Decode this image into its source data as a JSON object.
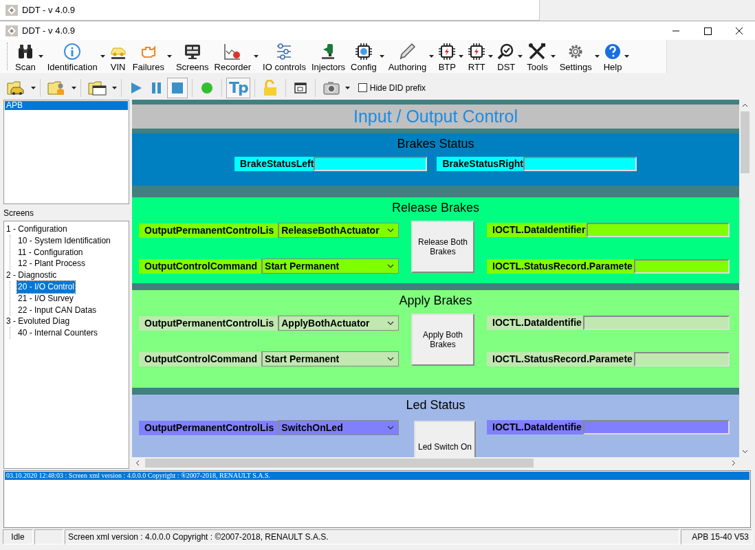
{
  "outer_window": {
    "title": "DDT - v 4.0.9"
  },
  "window": {
    "title": "DDT - v 4.0.9"
  },
  "toolbar": [
    {
      "label": "Scan",
      "dropdown": true
    },
    {
      "label": "Identification",
      "dropdown": true
    },
    {
      "label": "VIN",
      "dropdown": false
    },
    {
      "label": "Failures",
      "dropdown": true
    },
    {
      "label": "Screens",
      "dropdown": false
    },
    {
      "label": "Recorder",
      "dropdown": true
    },
    {
      "label": "IO controls",
      "dropdown": false
    },
    {
      "label": "Injectors",
      "dropdown": false
    },
    {
      "label": "Config",
      "dropdown": true
    },
    {
      "label": "Authoring",
      "dropdown": true
    },
    {
      "label": "BTP",
      "dropdown": true
    },
    {
      "label": "RTT",
      "dropdown": true
    },
    {
      "label": "DST",
      "dropdown": true
    },
    {
      "label": "Tools",
      "dropdown": true
    },
    {
      "label": "Settings",
      "dropdown": true
    },
    {
      "label": "Help",
      "dropdown": true
    }
  ],
  "tool_buttons": [
    {
      "pressed": false,
      "dropdown": true
    },
    {
      "pressed": false,
      "dropdown": true
    },
    {
      "pressed": false,
      "dropdown": true
    },
    {
      "pressed": false,
      "dropdown": false
    },
    {
      "pressed": false,
      "dropdown": false
    },
    {
      "pressed": true,
      "dropdown": false
    },
    {
      "pressed": false,
      "dropdown": false
    },
    {
      "pressed": true,
      "dropdown": false,
      "text": "Tp"
    },
    {
      "pressed": false,
      "dropdown": false
    },
    {
      "pressed": false,
      "dropdown": false
    },
    {
      "pressed": false,
      "dropdown": true
    }
  ],
  "hide_did_prefix": {
    "label": "Hide DID prefix",
    "checked": false
  },
  "ecu_list": [
    {
      "label": "APB",
      "selected": true
    }
  ],
  "screens_label": "Screens",
  "tree": [
    {
      "label": "1 - Configuration",
      "selected": false,
      "children": [
        {
          "label": "10 - System Identification",
          "selected": false
        },
        {
          "label": "11 - Configuration",
          "selected": false
        },
        {
          "label": "12 - Plant Process",
          "selected": false
        }
      ]
    },
    {
      "label": "2 - Diagnostic",
      "selected": false,
      "children": [
        {
          "label": "20 - I/O Control",
          "selected": true
        },
        {
          "label": "21 - I/O Survey",
          "selected": false
        },
        {
          "label": "22 - Input CAN Datas",
          "selected": false
        }
      ]
    },
    {
      "label": "3 - Evoluted Diag",
      "selected": false,
      "children": [
        {
          "label": "40 - Internal Counters",
          "selected": false
        }
      ]
    }
  ],
  "screen": {
    "title": "Input / Output Control",
    "sections": [
      {
        "kind": "status",
        "title": "Brakes Status",
        "color": "#0080c0",
        "fields": [
          {
            "label": "BrakeStatusLeft",
            "color": "#00ffff"
          },
          {
            "label": "BrakeStatusRight",
            "color": "#00ffff"
          }
        ]
      },
      {
        "kind": "control",
        "title": "Release Brakes",
        "color": "#00ff80",
        "rows": [
          {
            "label": "OutputPermanentControlLis",
            "value": "ReleaseBothActuator",
            "color": "#80ff00"
          },
          {
            "label": "OutputControlCommand",
            "value": "Start Permanent",
            "color": "#80ff00"
          }
        ],
        "button": "Release Both Brakes",
        "outputs": [
          {
            "label": "IOCTL.DataIdentifier",
            "color": "#80ff00"
          },
          {
            "label": "IOCTL.StatusRecord.Paramete",
            "color": "#80ff00"
          }
        ]
      },
      {
        "kind": "control",
        "title": "Apply Brakes",
        "color": "#80ff80",
        "rows": [
          {
            "label": "OutputPermanentControlLis",
            "value": "ApplyBothActuator",
            "color": "#c0e8b0"
          },
          {
            "label": "OutputControlCommand",
            "value": "Start Permanent",
            "color": "#c0e8b0"
          }
        ],
        "button": "Apply Both Brakes",
        "outputs": [
          {
            "label": "IOCTL.DataIdentifie",
            "color": "#c0e8b0"
          },
          {
            "label": "IOCTL.StatusRecord.Paramete",
            "color": "#c0e8b0"
          }
        ]
      },
      {
        "kind": "control",
        "title": "Led Status",
        "color": "#a0b8e8",
        "rows": [
          {
            "label": "OutputPermanentControlLis",
            "value": "SwitchOnLed",
            "color": "#8080ff"
          }
        ],
        "button": "Led Switch On",
        "outputs": [
          {
            "label": "IOCTL.DataIdentifie",
            "color": "#8080ff"
          }
        ]
      }
    ]
  },
  "log": [
    {
      "text": "03.10.2020 12:48:03 : Screen xml version : 4.0.0.0  Copyright : ®2007-2018, RENAULT S.A.S.",
      "selected": true
    }
  ],
  "status_bar": {
    "state": "Idle",
    "message": "Screen xml version : 4.0.0.0   Copyright : ©2007-2018, RENAULT S.A.S.",
    "ecu": "APB 15-40 V53"
  }
}
